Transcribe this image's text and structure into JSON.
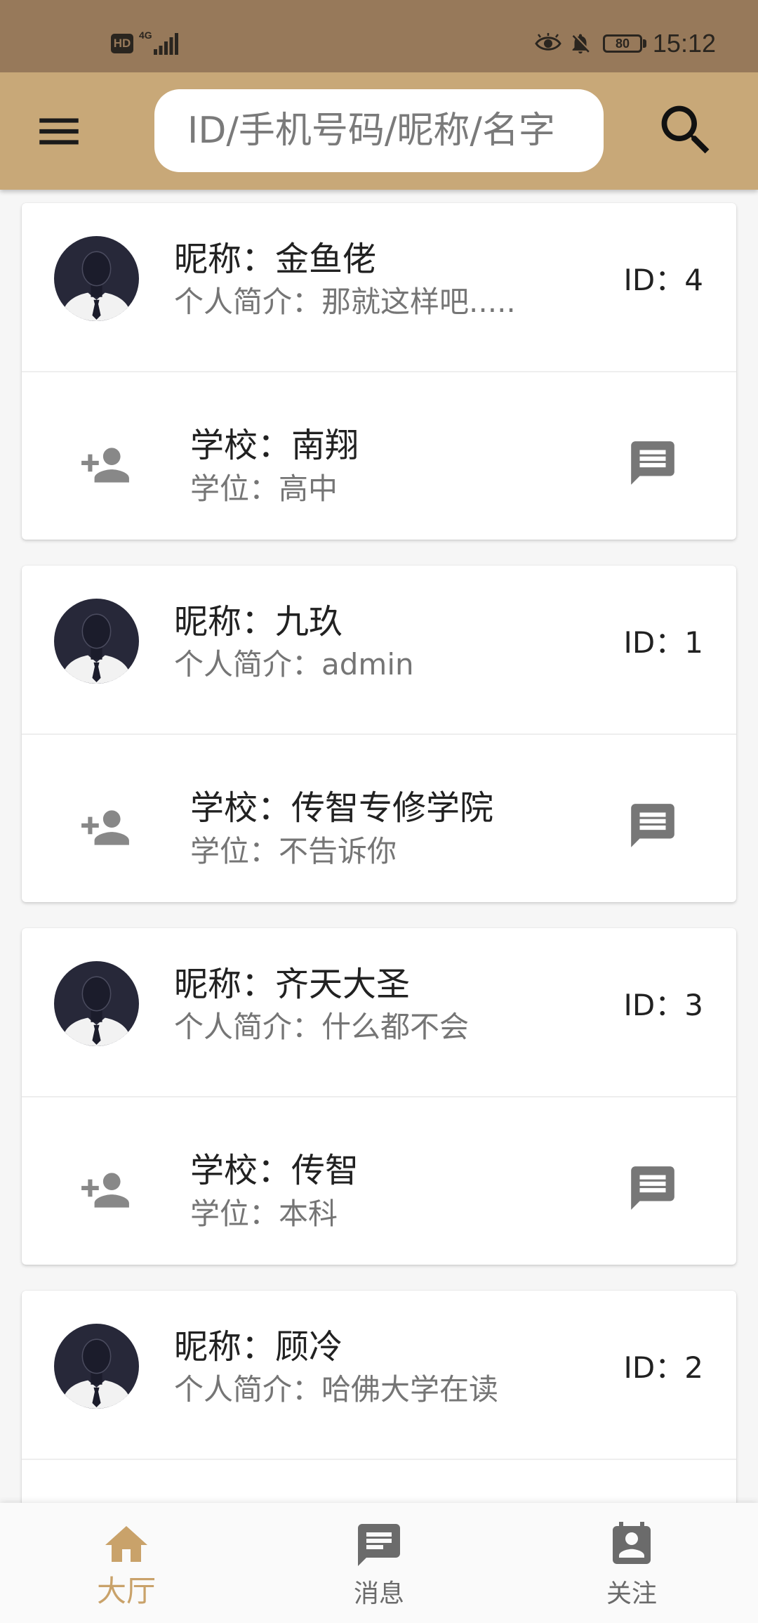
{
  "theme": {
    "status_bar": "#97795a",
    "app_bar": "#c8a878",
    "accent": "#c9a26a",
    "inactive": "#6b6b6b"
  },
  "status_bar": {
    "hd_badge": "HD",
    "network": "4G",
    "battery": "80",
    "time": "15:12",
    "icons": [
      "signal-icon",
      "eye-comfort-icon",
      "bell-off-icon",
      "battery-icon"
    ]
  },
  "app_bar": {
    "menu_icon": "menu-icon",
    "search_placeholder": "ID/手机号码/昵称/名字",
    "search_icon": "search-icon"
  },
  "labels": {
    "nickname": "昵称：",
    "bio": "个人简介：",
    "id": "ID：",
    "school": "学校：",
    "degree": "学位："
  },
  "card_icons": {
    "avatar": "avatar",
    "add_friend": "person-add-icon",
    "message": "message-icon"
  },
  "users": [
    {
      "nickname": "金鱼佬",
      "bio": "那就这样吧.....",
      "id": "4",
      "school": "南翔",
      "degree": "高中"
    },
    {
      "nickname": "九玖",
      "bio": "admin",
      "id": "1",
      "school": "传智专修学院",
      "degree": "不告诉你"
    },
    {
      "nickname": "齐天大圣",
      "bio": "什么都不会",
      "id": "3",
      "school": "传智",
      "degree": "本科"
    },
    {
      "nickname": "顾冷",
      "bio": "哈佛大学在读",
      "id": "2"
    }
  ],
  "bottom_nav": {
    "items": [
      {
        "label": "大厅",
        "icon": "home-icon",
        "active": true
      },
      {
        "label": "消息",
        "icon": "chat-icon",
        "active": false
      },
      {
        "label": "关注",
        "icon": "contact-calendar-icon",
        "active": false
      }
    ]
  }
}
